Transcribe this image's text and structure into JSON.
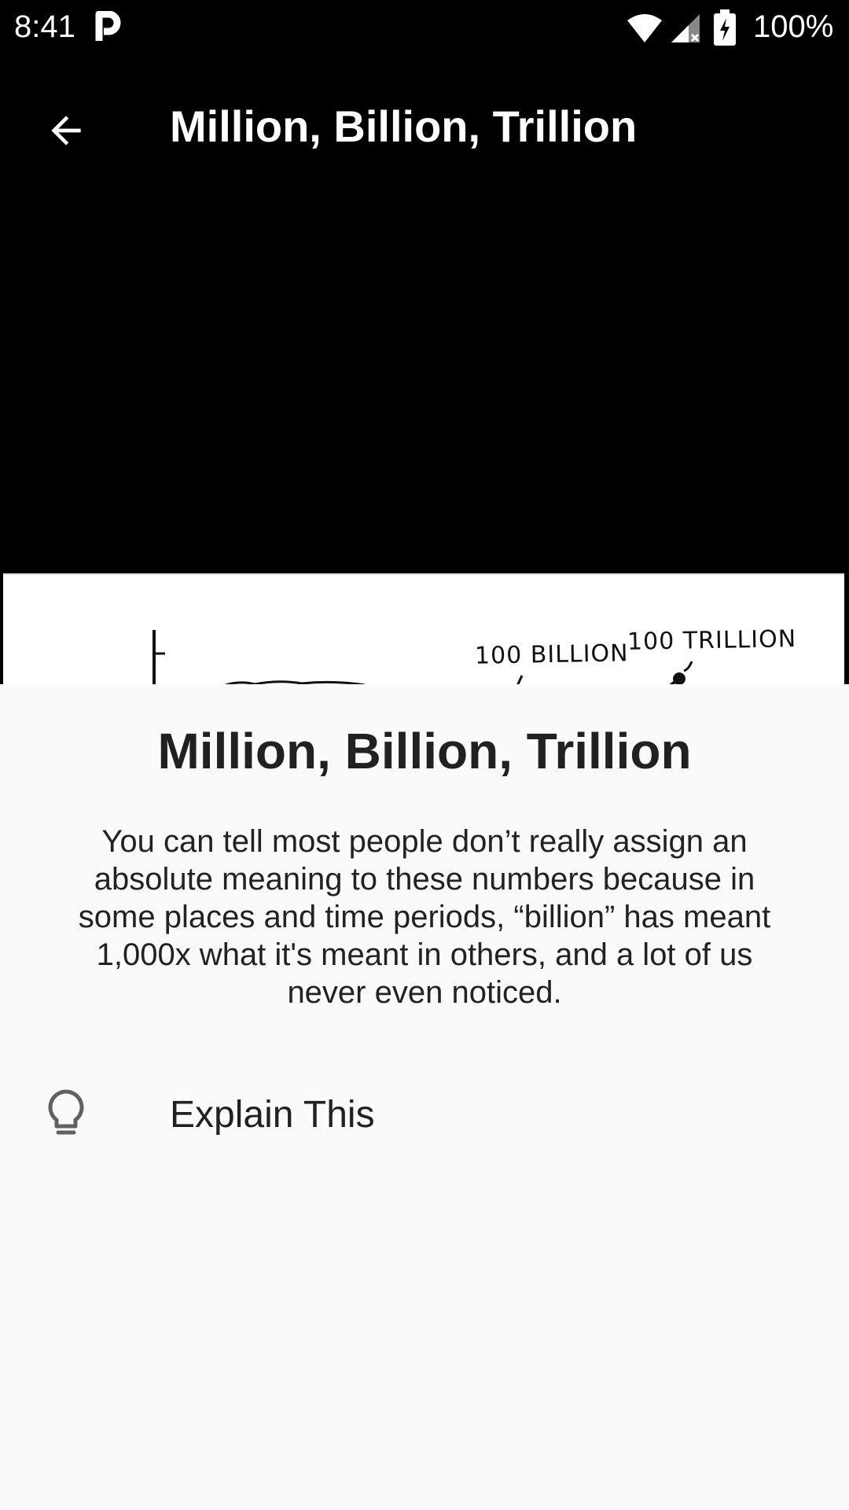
{
  "status_bar": {
    "time": "8:41",
    "battery_percent": "100%",
    "icons": [
      "parking-icon",
      "wifi-icon",
      "signal-icon",
      "battery-icon"
    ]
  },
  "toolbar": {
    "title": "Million, Billion, Trillion",
    "back_icon": "arrow-back-icon"
  },
  "comic": {
    "label_billion": "100 BILLION",
    "label_trillion": "100 TRILLION"
  },
  "sheet": {
    "title": "Million, Billion, Trillion",
    "description": "You can tell most people don’t really assign an absolute meaning to these numbers because in some places and time periods, “billion” has meant 1,000x what it's meant in others, and a lot of us never even noticed.",
    "explain_label": "Explain This",
    "explain_icon": "lightbulb-icon"
  },
  "colors": {
    "background_dark": "#000000",
    "sheet_background": "#fafafa",
    "text_primary": "#212121",
    "icon_gray": "#616161"
  }
}
